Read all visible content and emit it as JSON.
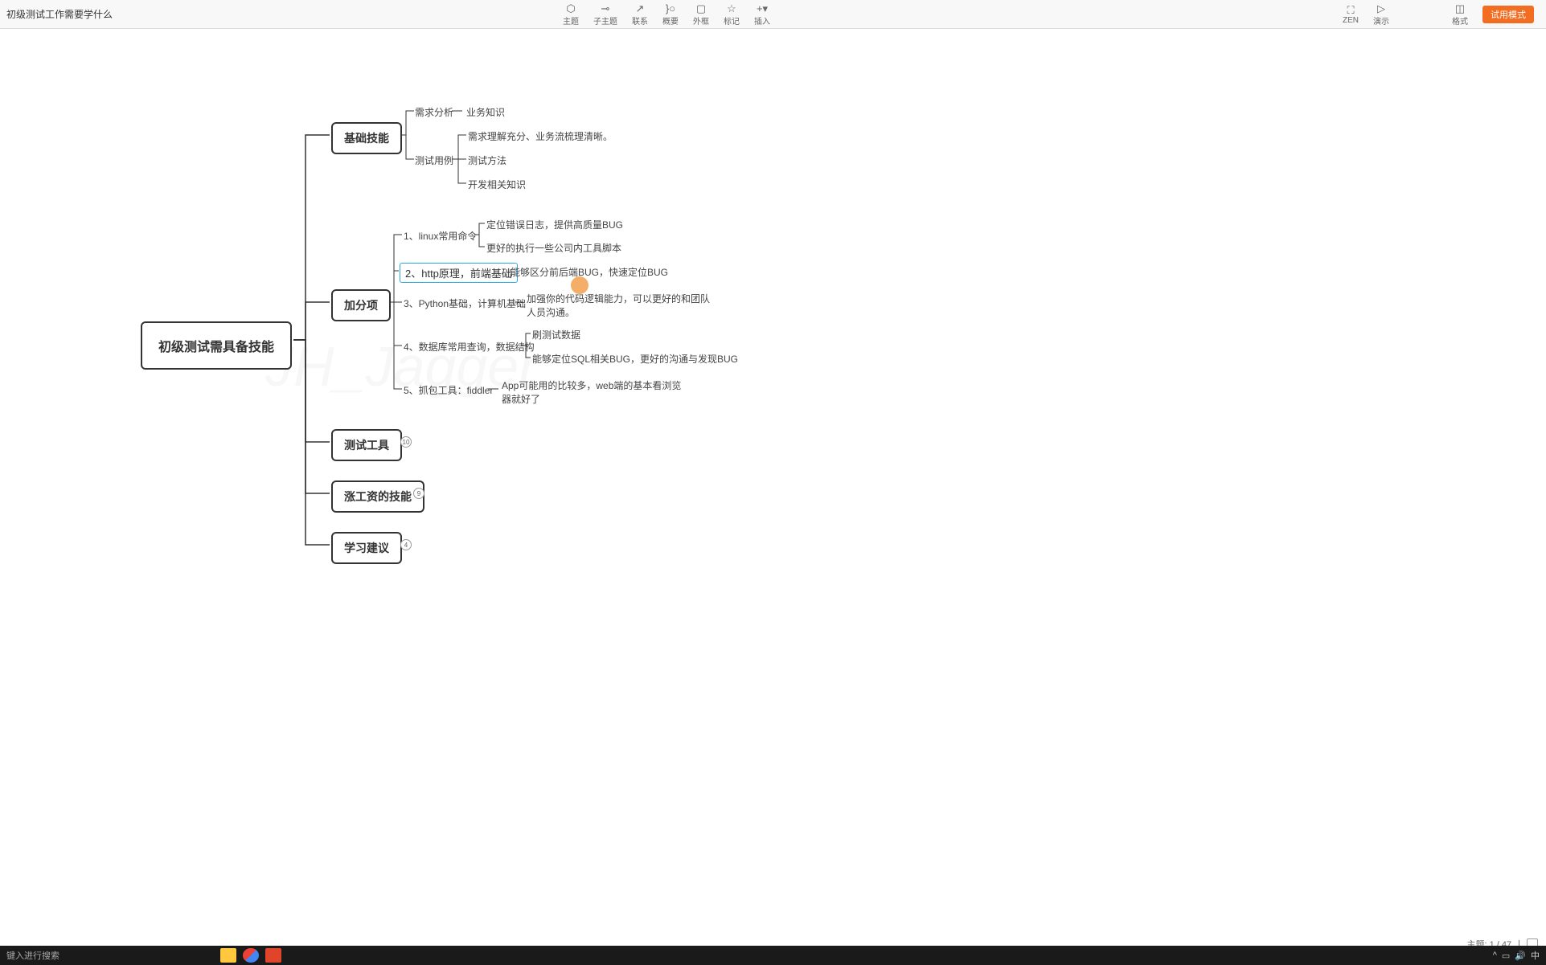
{
  "title": "初级测试工作需要学什么",
  "toolbar": {
    "theme": "主题",
    "subtheme": "子主题",
    "relate": "联系",
    "summary": "概要",
    "boundary": "外框",
    "marker": "标记",
    "insert": "插入",
    "zen": "ZEN",
    "present": "演示",
    "format": "格式",
    "trial": "试用模式"
  },
  "mindmap": {
    "root": "初级测试需具备技能",
    "l2": {
      "basic": "基础技能",
      "bonus": "加分项",
      "tools": "测试工具",
      "salary": "涨工资的技能",
      "advice": "学习建议"
    },
    "badges": {
      "tools": "10",
      "salary": "9",
      "advice": "4"
    },
    "basic": {
      "req": "需求分析",
      "req_leaf": "业务知识",
      "case": "测试用例",
      "case_leaf1": "需求理解充分、业务流梳理清晰。",
      "case_leaf2": "测试方法",
      "case_leaf3": "开发相关知识"
    },
    "bonus": {
      "n1": "1、linux常用命令",
      "n1_a": "定位错误日志，提供高质量BUG",
      "n1_b": "更好的执行一些公司内工具脚本",
      "n2": "2、http原理，前端基础",
      "n2_a": "能够区分前后端BUG，快速定位BUG",
      "n3": "3、Python基础，计算机基础",
      "n3_a": "加强你的代码逻辑能力，可以更好的和团队人员沟通。",
      "n4": "4、数据库常用查询，数据结构",
      "n4_a": "刷测试数据",
      "n4_b": "能够定位SQL相关BUG，更好的沟通与发现BUG",
      "n5": "5、抓包工具：fiddler",
      "n5_a": "App可能用的比较多，web端的基本看浏览器就好了"
    }
  },
  "watermark": "JH_Jagger",
  "status": {
    "topic": "主题: 1 / 47"
  },
  "taskbar": {
    "search": "键入进行搜索",
    "ime": "中"
  }
}
